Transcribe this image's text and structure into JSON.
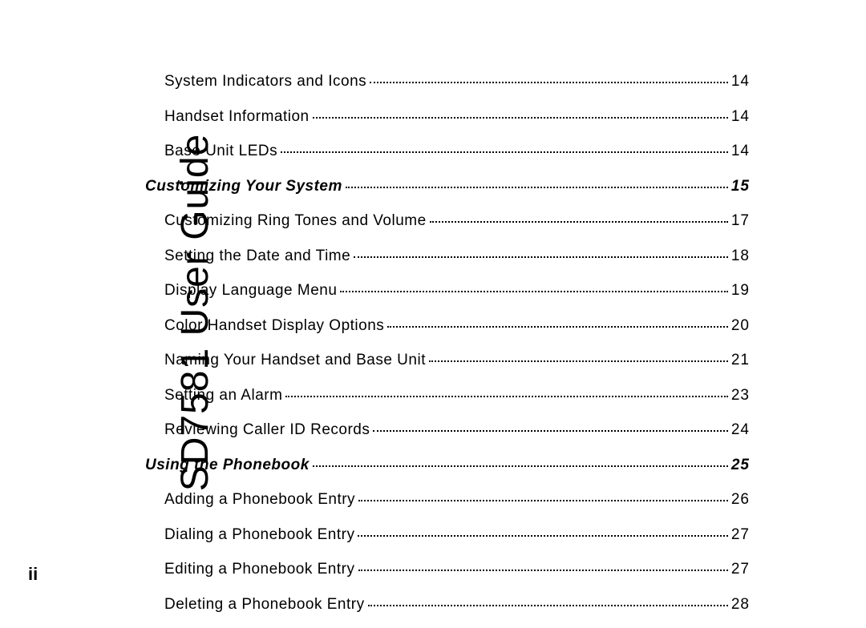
{
  "document": {
    "sidebar_title": "SD7581 User Guide",
    "page_number": "ii"
  },
  "toc": [
    {
      "type": "entry",
      "title": "System Indicators and Icons",
      "page": "14"
    },
    {
      "type": "entry",
      "title": "Handset Information",
      "page": "14"
    },
    {
      "type": "entry",
      "title": "Base Unit LEDs",
      "page": "14"
    },
    {
      "type": "section",
      "title": "Customizing Your System",
      "page": "15"
    },
    {
      "type": "entry",
      "title": "Customizing Ring Tones and Volume",
      "page": "17"
    },
    {
      "type": "entry",
      "title": "Setting the Date and Time",
      "page": "18"
    },
    {
      "type": "entry",
      "title": "Display Language Menu",
      "page": "19"
    },
    {
      "type": "entry",
      "title": "Color Handset Display Options",
      "page": "20"
    },
    {
      "type": "entry",
      "title": "Naming Your Handset and Base Unit",
      "page": "21"
    },
    {
      "type": "entry",
      "title": "Setting an Alarm",
      "page": "23"
    },
    {
      "type": "entry",
      "title": "Reviewing Caller ID Records",
      "page": "24"
    },
    {
      "type": "section",
      "title": "Using the Phonebook",
      "page": "25"
    },
    {
      "type": "entry",
      "title": "Adding a Phonebook Entry",
      "page": "26"
    },
    {
      "type": "entry",
      "title": "Dialing a Phonebook Entry",
      "page": "27"
    },
    {
      "type": "entry",
      "title": "Editing a Phonebook Entry",
      "page": "27"
    },
    {
      "type": "entry",
      "title": "Deleting a Phonebook Entry",
      "page": "28"
    }
  ]
}
